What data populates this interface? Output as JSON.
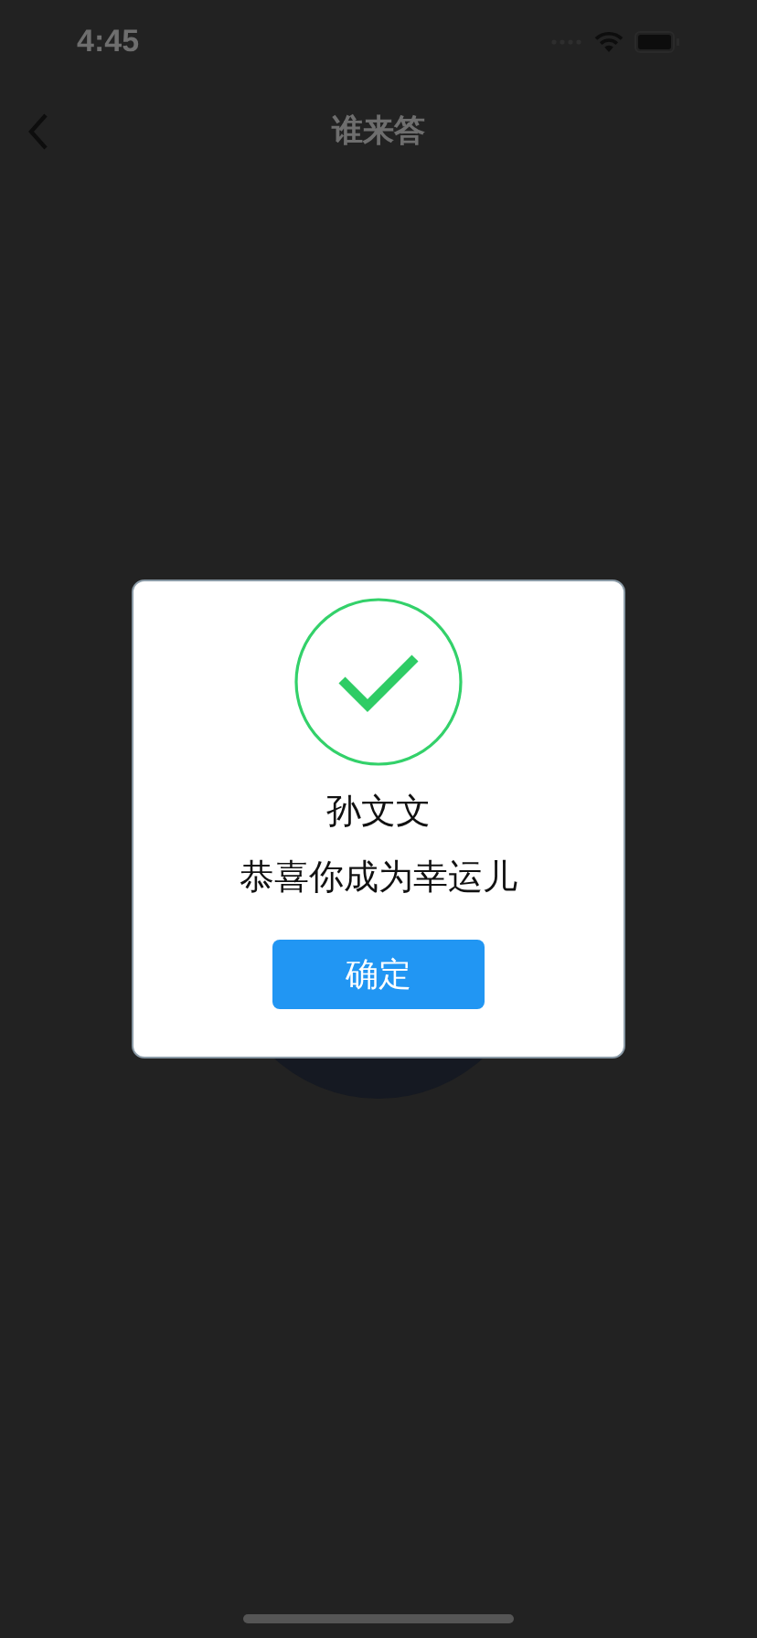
{
  "status_bar": {
    "time": "4:45"
  },
  "header": {
    "title": "谁来答"
  },
  "dialog": {
    "name": "孙文文",
    "message": "恭喜你成为幸运儿",
    "confirm_button": "确定"
  }
}
